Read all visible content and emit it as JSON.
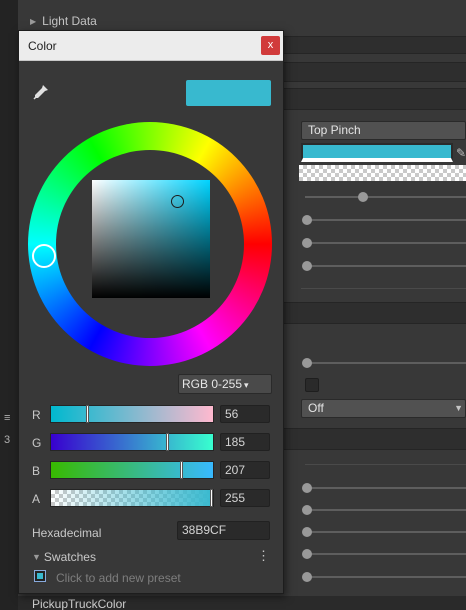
{
  "inspector": {
    "light_data_label": "Light Data",
    "dropdown_value": "Top Pinch",
    "off_dropdown_value": "Off",
    "bottom_label": "PickupTruckColor",
    "left_marks": [
      "≡",
      "3"
    ],
    "current_color_hex": "#38B9CF"
  },
  "color_window": {
    "title": "Color",
    "close_glyph": "x",
    "mode": "RGB 0-255",
    "mode_caret": "▾",
    "channels": [
      {
        "label": "R",
        "value": "56",
        "fraction": 0.22
      },
      {
        "label": "G",
        "value": "185",
        "fraction": 0.725
      },
      {
        "label": "B",
        "value": "207",
        "fraction": 0.81
      },
      {
        "label": "A",
        "value": "255",
        "fraction": 1.0
      }
    ],
    "hex_label": "Hexadecimal",
    "hex_value": "38B9CF",
    "swatches_label": "Swatches",
    "swatches_menu": "⋮",
    "add_preset_text": "Click to add new preset",
    "icons": {
      "eyedropper": "eyedropper-icon",
      "close": "close-icon",
      "menu": "kebab-menu-icon"
    },
    "colors": {
      "selected": "#38B9CF",
      "close_button": "#D13B3B"
    }
  }
}
